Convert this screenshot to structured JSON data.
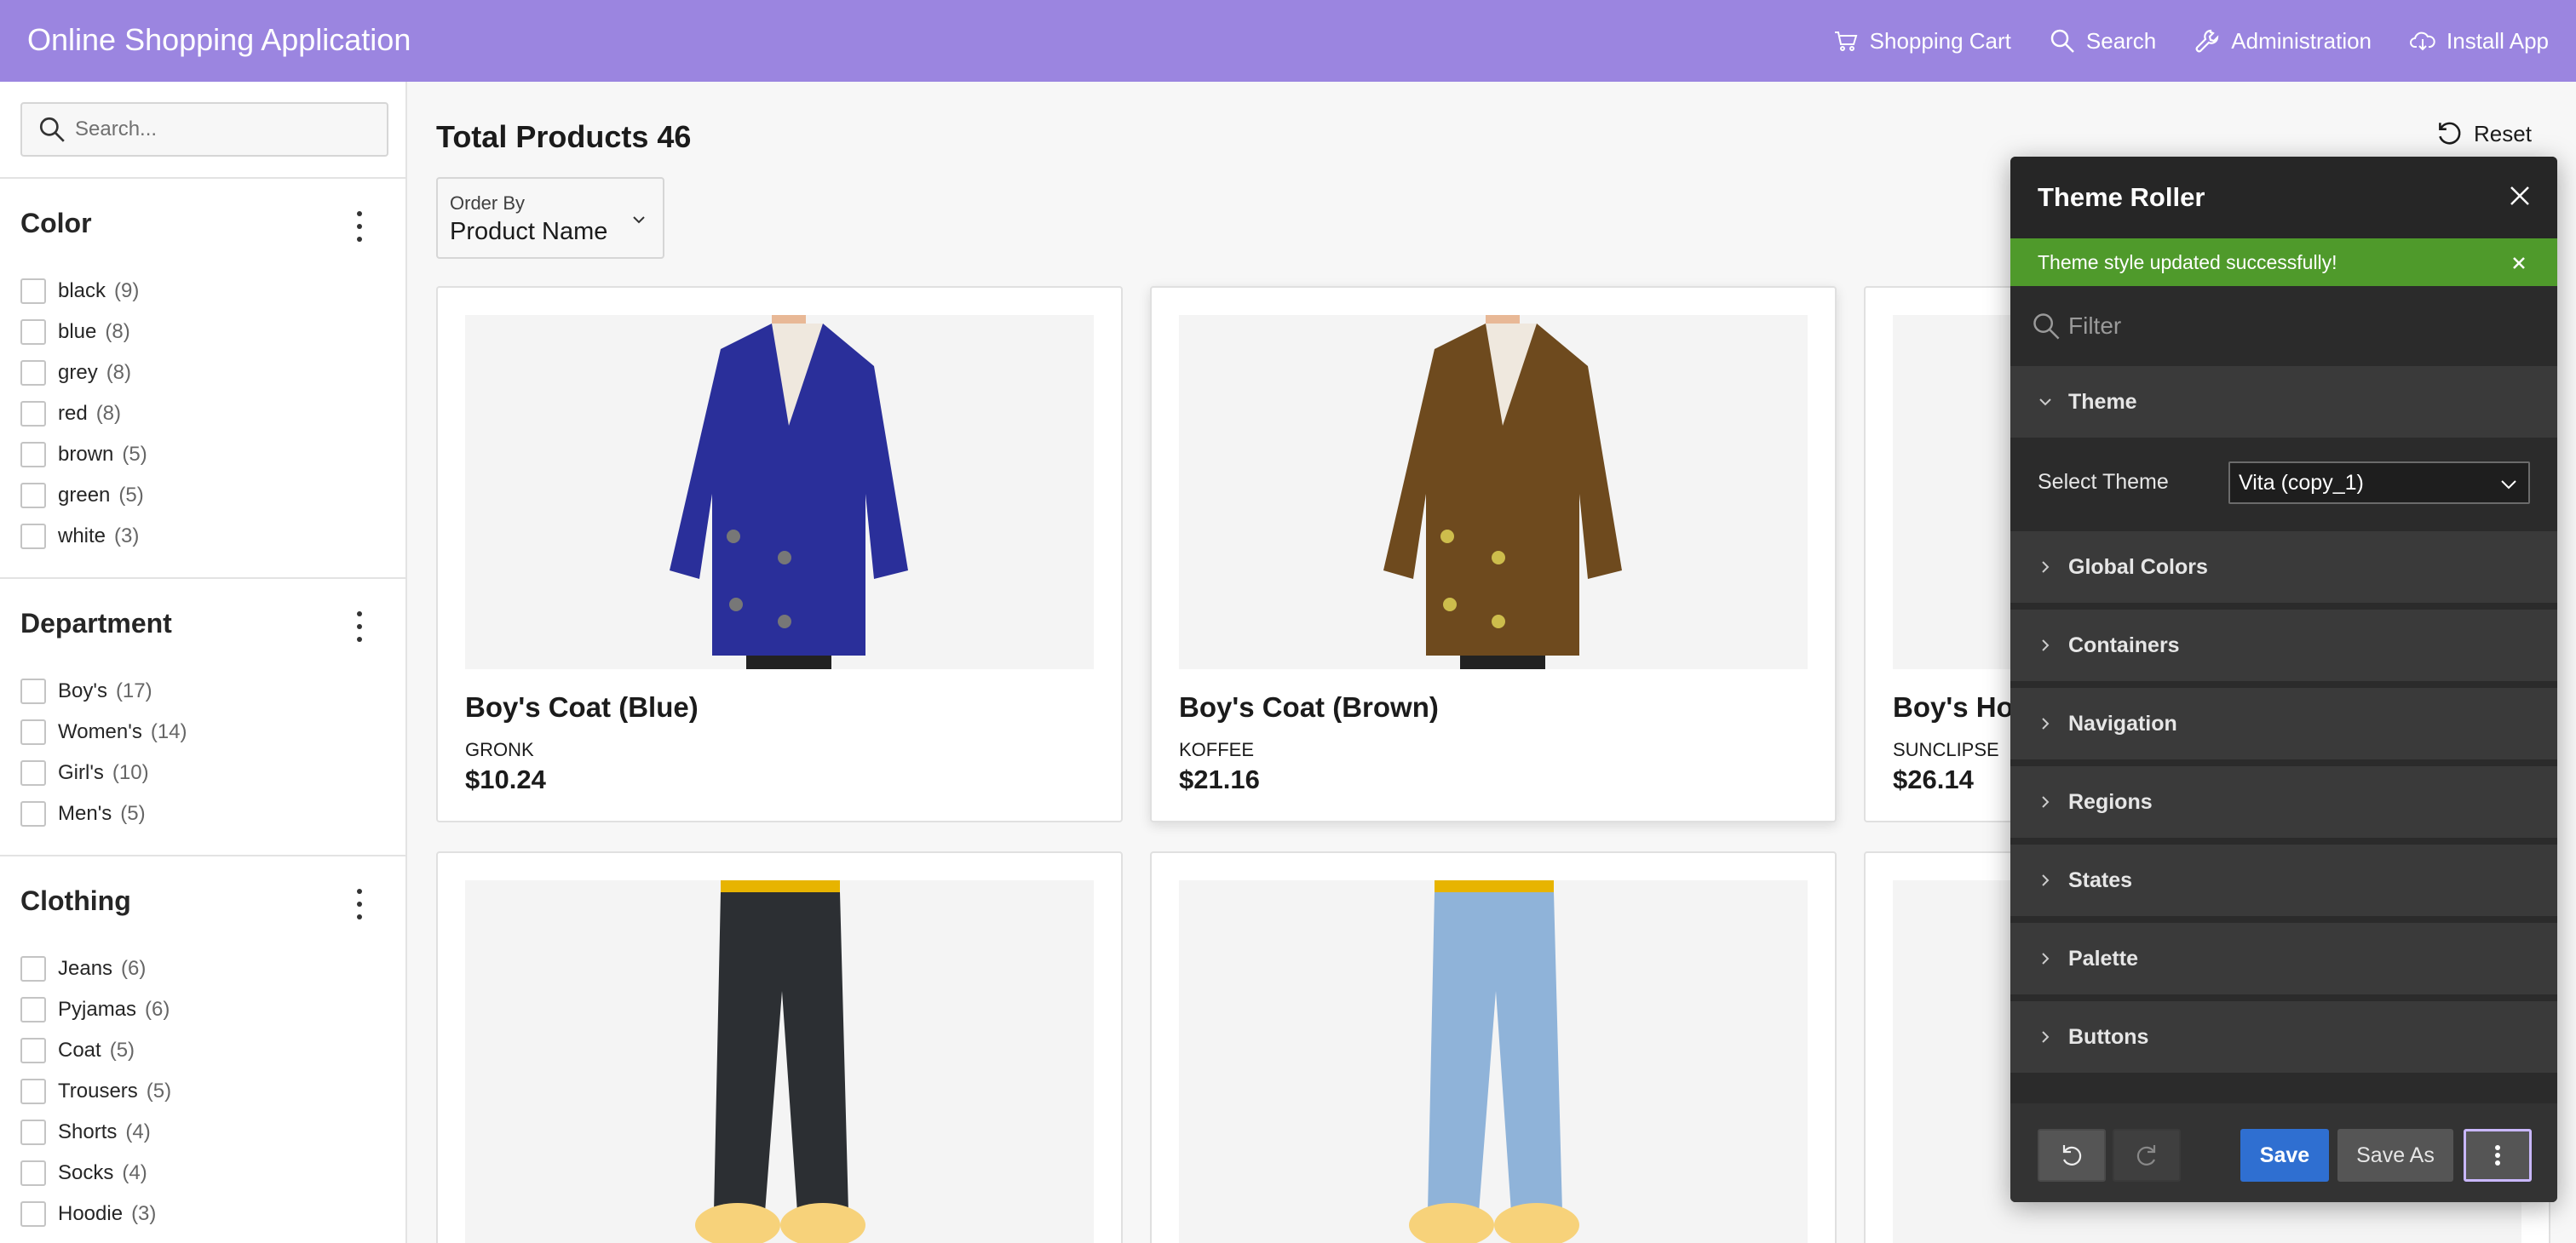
{
  "header": {
    "title": "Online Shopping Application",
    "nav": [
      {
        "label": "Shopping Cart",
        "icon": "cart-icon"
      },
      {
        "label": "Search",
        "icon": "search-icon"
      },
      {
        "label": "Administration",
        "icon": "wrench-icon"
      },
      {
        "label": "Install App",
        "icon": "cloud-download-icon"
      }
    ],
    "color": "#9b85e0"
  },
  "sidebar": {
    "search_placeholder": "Search...",
    "facets": [
      {
        "title": "Color",
        "options": [
          {
            "label": "black",
            "count": "(9)"
          },
          {
            "label": "blue",
            "count": "(8)"
          },
          {
            "label": "grey",
            "count": "(8)"
          },
          {
            "label": "red",
            "count": "(8)"
          },
          {
            "label": "brown",
            "count": "(5)"
          },
          {
            "label": "green",
            "count": "(5)"
          },
          {
            "label": "white",
            "count": "(3)"
          }
        ]
      },
      {
        "title": "Department",
        "options": [
          {
            "label": "Boy's",
            "count": "(17)"
          },
          {
            "label": "Women's",
            "count": "(14)"
          },
          {
            "label": "Girl's",
            "count": "(10)"
          },
          {
            "label": "Men's",
            "count": "(5)"
          }
        ]
      },
      {
        "title": "Clothing",
        "options": [
          {
            "label": "Jeans",
            "count": "(6)"
          },
          {
            "label": "Pyjamas",
            "count": "(6)"
          },
          {
            "label": "Coat",
            "count": "(5)"
          },
          {
            "label": "Trousers",
            "count": "(5)"
          },
          {
            "label": "Shorts",
            "count": "(4)"
          },
          {
            "label": "Socks",
            "count": "(4)"
          },
          {
            "label": "Hoodie",
            "count": "(3)"
          }
        ]
      }
    ]
  },
  "main": {
    "total_label": "Total Products 46",
    "reset_label": "Reset",
    "order_by": {
      "label": "Order By",
      "value": "Product Name"
    },
    "products": [
      {
        "name": "Boy's Coat (Blue)",
        "brand": "GRONK",
        "price": "$10.24",
        "color": "#2a2f9a"
      },
      {
        "name": "Boy's Coat (Brown)",
        "brand": "KOFFEE",
        "price": "$21.16",
        "color": "#6e4a1e"
      },
      {
        "name": "Boy's Ho",
        "brand": "SUNCLIPSE",
        "price": "$26.14",
        "color": "#888888"
      },
      {
        "name": "",
        "brand": "",
        "price": "",
        "color": "#2c2f33"
      },
      {
        "name": "",
        "brand": "",
        "price": "",
        "color": "#8fb3d9"
      },
      {
        "name": "",
        "brand": "",
        "price": "",
        "color": "#7d7d7d"
      }
    ]
  },
  "theme_roller": {
    "title": "Theme Roller",
    "message": "Theme style updated successfully!",
    "filter_placeholder": "Filter",
    "theme_section": "Theme",
    "select_theme_label": "Select Theme",
    "select_theme_value": "Vita (copy_1)",
    "sections": [
      "Global Colors",
      "Containers",
      "Navigation",
      "Regions",
      "States",
      "Palette",
      "Buttons"
    ],
    "buttons": {
      "save": "Save",
      "save_as": "Save As"
    },
    "colors": {
      "success": "#4f9a2b",
      "save": "#2f6fd1",
      "panel": "#2b2b2b"
    }
  }
}
